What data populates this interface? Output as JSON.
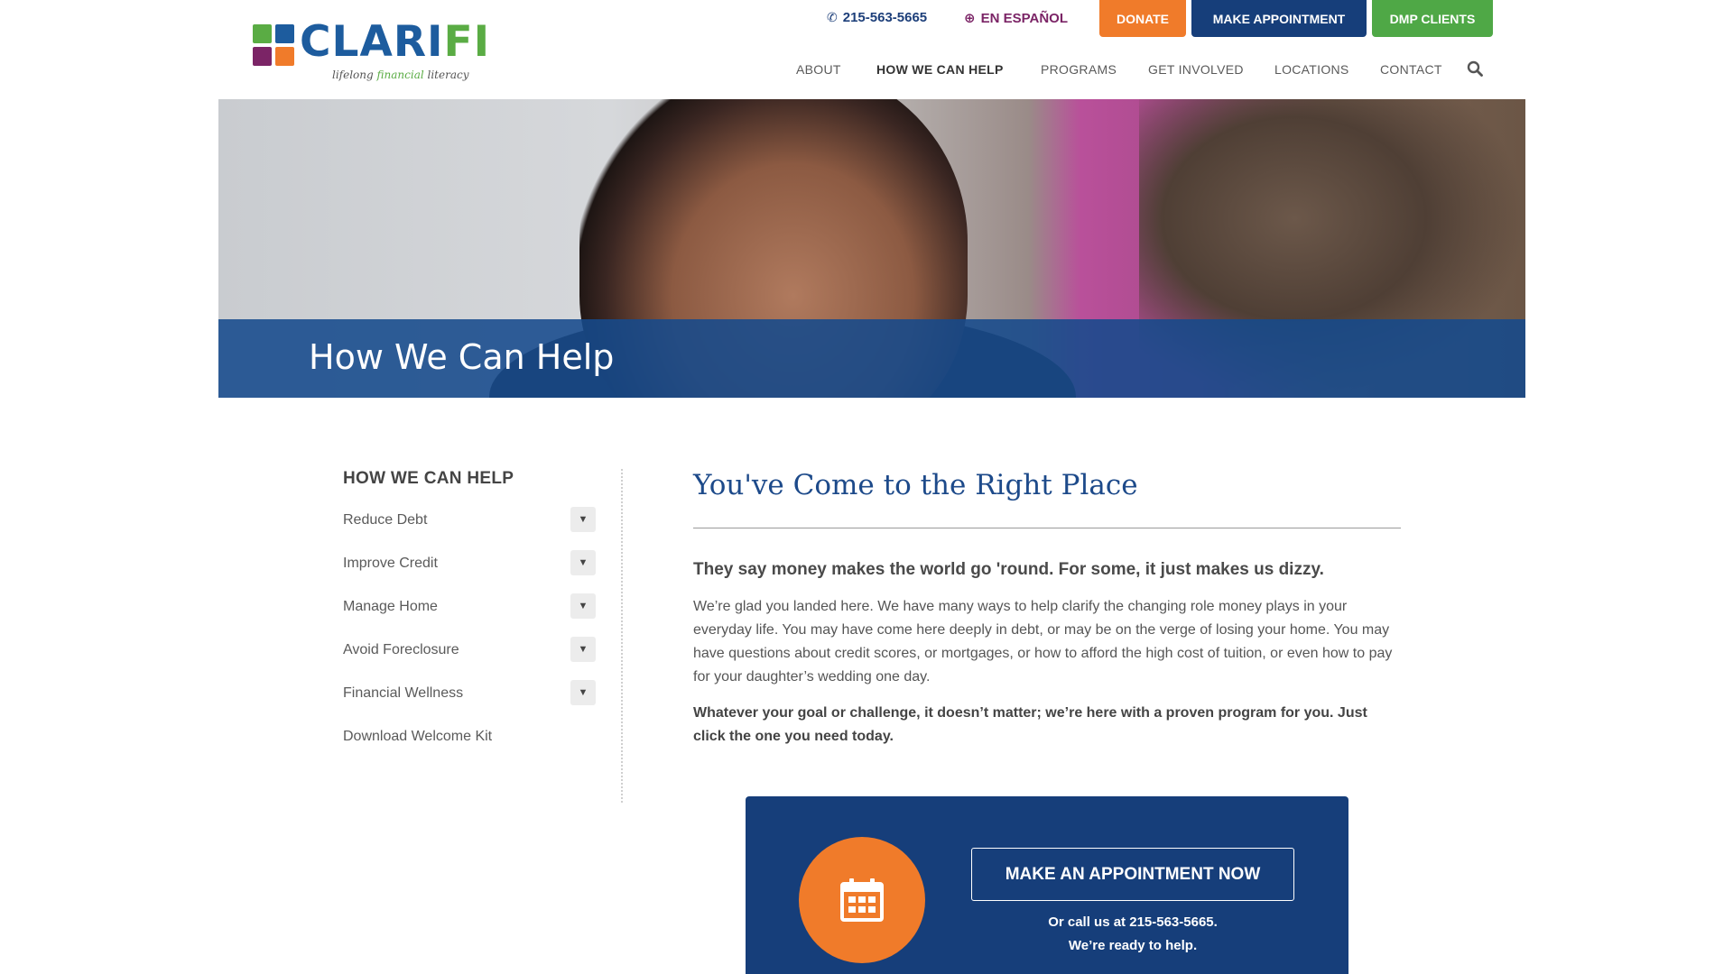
{
  "header": {
    "logo": {
      "word_main": "CLARI",
      "word_accent": "FI",
      "tag_before": "lifelong ",
      "tag_accent": "financial",
      "tag_after": " literacy"
    },
    "utility": {
      "phone": "215-563-5665",
      "language": "EN ESPAÑOL",
      "donate": "DONATE",
      "appointment": "MAKE APPOINTMENT",
      "dmp": "DMP CLIENTS"
    },
    "nav": {
      "about": "ABOUT",
      "help": "HOW WE CAN HELP",
      "programs": "PROGRAMS",
      "involved": "GET INVOLVED",
      "locations": "LOCATIONS",
      "contact": "CONTACT",
      "search_icon": "search-icon"
    }
  },
  "hero": {
    "title": "How We Can Help"
  },
  "sidebar": {
    "title": "HOW WE CAN HELP",
    "items": [
      {
        "label": "Reduce Debt",
        "toggle": "▼"
      },
      {
        "label": "Improve Credit",
        "toggle": "▼"
      },
      {
        "label": "Manage Home",
        "toggle": "▼"
      },
      {
        "label": "Avoid Foreclosure",
        "toggle": "▼"
      },
      {
        "label": "Financial Wellness",
        "toggle": "▼"
      },
      {
        "label": "Download Welcome Kit"
      }
    ]
  },
  "main": {
    "heading": "You've Come to the Right Place",
    "lead": "They say money makes the world go 'round. For some, it just makes us dizzy.",
    "body": "We’re glad you landed here. We have many ways to help clarify the changing role money plays in your everyday life. You may have come here deeply in debt, or may be on the verge of losing your home. You may have questions about credit scores, or mortgages, or how to afford the high cost of tuition, or even how to pay for your daughter’s wedding one day.",
    "strong": "Whatever your goal or challenge, it doesn’t matter; we’re here with a proven program for you. Just click the one you need today."
  },
  "cta": {
    "button": "MAKE AN APPOINTMENT NOW",
    "line1": "Or call us at 215-563-5665.",
    "line2": "We’re ready to help.",
    "icon": "calendar-icon"
  },
  "colors": {
    "brand_blue": "#1d5c9e",
    "navy": "#163e7a",
    "orange": "#f07b2a",
    "green": "#4fa846",
    "purple": "#7b2466"
  }
}
